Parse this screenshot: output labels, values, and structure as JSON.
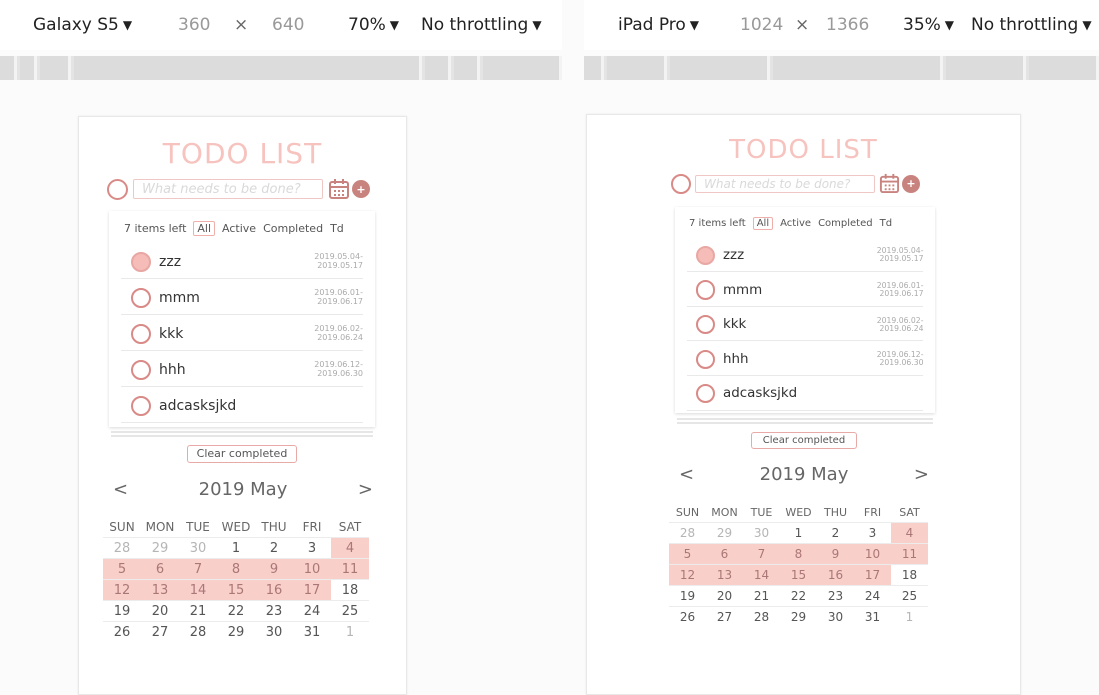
{
  "devtools": {
    "left": {
      "device": "Galaxy S5",
      "width": "360",
      "times": "×",
      "height": "640",
      "zoom": "70%",
      "throttle": "No throttling"
    },
    "right": {
      "device": "iPad Pro",
      "width": "1024",
      "times": "×",
      "height": "1366",
      "zoom": "35%",
      "throttle": "No throttling"
    },
    "dropdown_glyph": "▼"
  },
  "app": {
    "title": "TODO LIST",
    "input_placeholder": "What needs to be done?",
    "add_glyph": "+",
    "filters": {
      "items_left": "7 items left",
      "all": "All",
      "active": "Active",
      "completed": "Completed",
      "td": "Td"
    },
    "todos": [
      {
        "text": "zzz",
        "date_start": "2019.05.04-",
        "date_end": "2019.05.17",
        "done": true
      },
      {
        "text": "mmm",
        "date_start": "2019.06.01-",
        "date_end": "2019.06.17",
        "done": false
      },
      {
        "text": "kkk",
        "date_start": "2019.06.02-",
        "date_end": "2019.06.24",
        "done": false
      },
      {
        "text": "hhh",
        "date_start": "2019.06.12-",
        "date_end": "2019.06.30",
        "done": false
      },
      {
        "text": "adcasksjkd",
        "date_start": "",
        "date_end": "",
        "done": false
      }
    ],
    "clear_completed": "Clear completed",
    "calendar": {
      "prev": "<",
      "next": ">",
      "month_label": "2019 May",
      "weekdays": [
        "SUN",
        "MON",
        "TUE",
        "WED",
        "THU",
        "FRI",
        "SAT"
      ],
      "weeks": [
        [
          {
            "d": "28",
            "other": true
          },
          {
            "d": "29",
            "other": true
          },
          {
            "d": "30",
            "other": true
          },
          {
            "d": "1"
          },
          {
            "d": "2"
          },
          {
            "d": "3"
          },
          {
            "d": "4",
            "sel": true
          }
        ],
        [
          {
            "d": "5",
            "sel": true
          },
          {
            "d": "6",
            "sel": true
          },
          {
            "d": "7",
            "sel": true
          },
          {
            "d": "8",
            "sel": true
          },
          {
            "d": "9",
            "sel": true
          },
          {
            "d": "10",
            "sel": true
          },
          {
            "d": "11",
            "sel": true
          }
        ],
        [
          {
            "d": "12",
            "sel": true
          },
          {
            "d": "13",
            "sel": true
          },
          {
            "d": "14",
            "sel": true
          },
          {
            "d": "15",
            "sel": true
          },
          {
            "d": "16",
            "sel": true
          },
          {
            "d": "17",
            "sel": true
          },
          {
            "d": "18"
          }
        ],
        [
          {
            "d": "19"
          },
          {
            "d": "20"
          },
          {
            "d": "21"
          },
          {
            "d": "22"
          },
          {
            "d": "23"
          },
          {
            "d": "24"
          },
          {
            "d": "25"
          }
        ],
        [
          {
            "d": "26"
          },
          {
            "d": "27"
          },
          {
            "d": "28"
          },
          {
            "d": "29"
          },
          {
            "d": "30"
          },
          {
            "d": "31"
          },
          {
            "d": "1",
            "other": true
          }
        ]
      ]
    }
  },
  "colors": {
    "title": "#f6c3bf",
    "accent": "#c9837f",
    "selected_day": "#f9cfca",
    "radio_border": "#d98a86"
  }
}
